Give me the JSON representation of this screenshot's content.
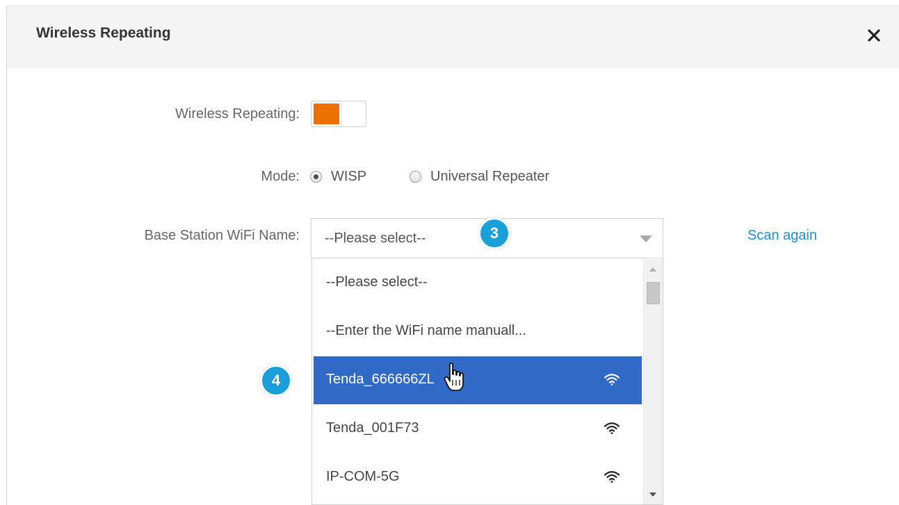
{
  "dialog": {
    "title": "Wireless Repeating",
    "close_icon": "close-icon"
  },
  "form": {
    "wireless_repeating_label": "Wireless Repeating:",
    "wireless_repeating_enabled": true,
    "toggle_color": "#ec7100",
    "mode_label": "Mode:",
    "mode_options": [
      {
        "label": "WISP",
        "checked": true
      },
      {
        "label": "Universal Repeater",
        "checked": false
      }
    ],
    "base_station_label": "Base Station WiFi Name:",
    "base_station_value": "--Please select--",
    "scan_again": "Scan again"
  },
  "dropdown": {
    "options": [
      {
        "label": "--Please select--",
        "signal": false,
        "selected": false
      },
      {
        "label": "--Enter the WiFi name manuall...",
        "signal": false,
        "selected": false
      },
      {
        "label": "Tenda_666666ZL",
        "signal": true,
        "selected": true
      },
      {
        "label": "Tenda_001F73",
        "signal": true,
        "selected": false
      },
      {
        "label": "IP-COM-5G",
        "signal": true,
        "selected": false
      }
    ],
    "selected_color": "#3169c6"
  },
  "callouts": {
    "step3": "3",
    "step4": "4",
    "color": "#1a9fd9"
  }
}
